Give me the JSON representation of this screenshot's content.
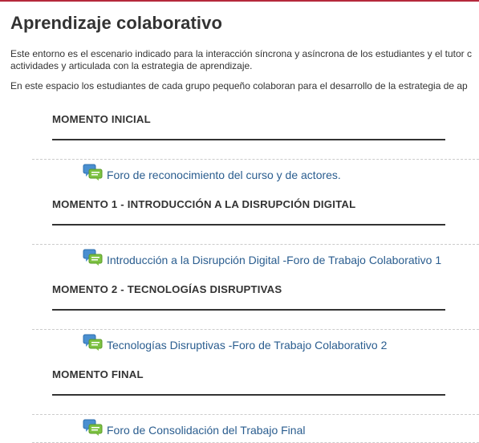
{
  "page": {
    "title": "Aprendizaje colaborativo",
    "intro_line1": "Este entorno es el escenario indicado para la interacción síncrona y asíncrona de los estudiantes y el tutor c",
    "intro_line2": "actividades y articulada con la estrategia de aprendizaje.",
    "intro_line3": "En este espacio los estudiantes de cada grupo pequeño colaboran para el desarrollo de la estrategia de ap"
  },
  "sections": [
    {
      "heading": "MOMENTO INICIAL",
      "activity": {
        "label": "Foro de reconocimiento del curso y de actores.",
        "icon": "forum-icon"
      }
    },
    {
      "heading": "MOMENTO 1 - INTRODUCCIÓN A LA DISRUPCIÓN DIGITAL",
      "activity": {
        "label": "Introducción a la Disrupción Digital -Foro de Trabajo Colaborativo 1",
        "icon": "forum-icon"
      }
    },
    {
      "heading": "MOMENTO 2 - TECNOLOGÍAS DISRUPTIVAS",
      "activity": {
        "label": "Tecnologías Disruptivas -Foro de Trabajo Colaborativo 2",
        "icon": "forum-icon"
      }
    },
    {
      "heading": "MOMENTO FINAL",
      "activity": {
        "label": "Foro de Consolidación del Trabajo Final",
        "icon": "forum-icon"
      }
    }
  ],
  "colors": {
    "accent_bar": "#b5283b",
    "link": "#2a5d8f",
    "forum_icon_blue": "#4a8fd0",
    "forum_icon_green": "#7dc242"
  }
}
